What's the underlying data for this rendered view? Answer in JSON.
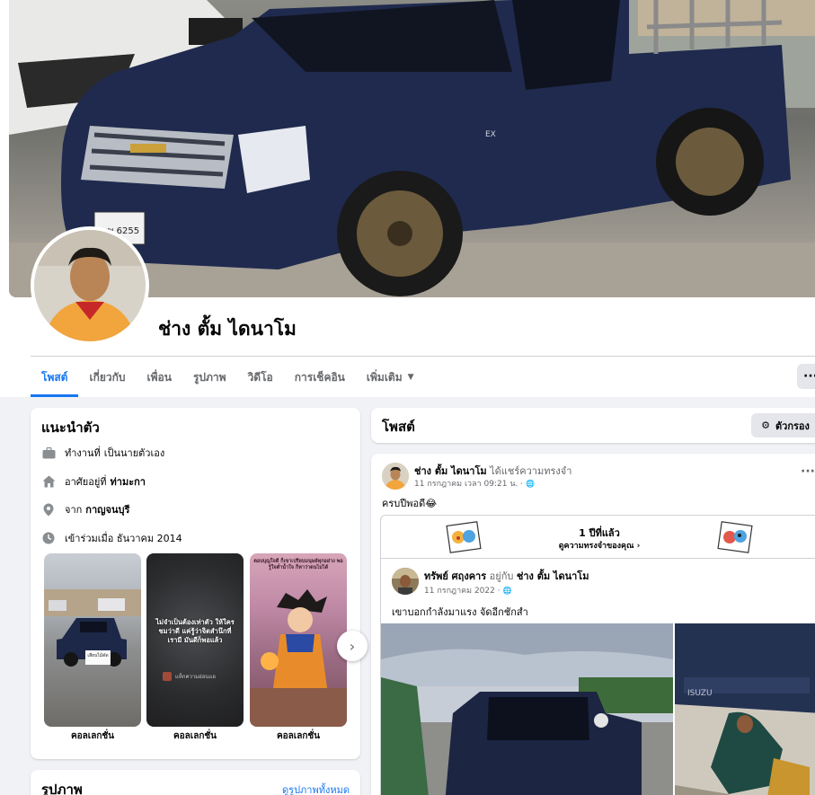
{
  "profile": {
    "name": "ช่าง ตั้ม ไดนาโม",
    "cover_plate": "ฒพ 6255",
    "cover_badge": "EX"
  },
  "tabs": [
    {
      "label": "โพสต์",
      "active": true
    },
    {
      "label": "เกี่ยวกับ"
    },
    {
      "label": "เพื่อน"
    },
    {
      "label": "รูปภาพ"
    },
    {
      "label": "วิดีโอ"
    },
    {
      "label": "การเช็คอิน"
    },
    {
      "label": "เพิ่มเติม"
    }
  ],
  "more_button": "···",
  "intro": {
    "title": "แนะนำตัว",
    "work": {
      "prefix": "ทำงานที่",
      "value": "เป็นนายตัวเอง"
    },
    "lives": {
      "prefix": "อาศัยอยู่ที่",
      "value": "ท่ามะกา"
    },
    "from": {
      "prefix": "จาก",
      "value": "กาญจนบุรี"
    },
    "joined": "เข้าร่วมเมื่อ ธันวาคม 2014",
    "collections": [
      {
        "label": "คอลเลกชั่น",
        "caption": "เสียบไม้ดัด"
      },
      {
        "label": "คอลเลกชั่น",
        "caption": "ไม่จำเป็นต้องเท่าตัว ให้ใครชมว่าดี แค่รู้ว่าจิตสำนึกที่เรามี มันดีก็พอแล้ว",
        "sub": "แท็กความอ่อนแอ"
      },
      {
        "label": "คอลเลกชั่น",
        "caption": "ตอบบุญใจดี ก็เขาเปรียบมนุษย์ทุกอย่าง พอรู้ใจต่ำน้ำใจ ก็หาว่าตนไม่ได้"
      }
    ]
  },
  "photos_card": {
    "title": "รูปภาพ",
    "link": "ดูรูปภาพทั้งหมด"
  },
  "posts_header": {
    "title": "โพสต์",
    "filter": "ตัวกรอง"
  },
  "post": {
    "author": "ช่าง ตั้ม ไดนาโม",
    "action": "ได้แชร์ความทรงจำ",
    "time": "11 กรกฎาคม เวลา 09:21 น. ·",
    "text": "ครบปีพอดี😂",
    "memory": {
      "title": "1 ปีที่แล้ว",
      "subtitle": "ดูความทรงจำของคุณ",
      "shared_author": "ทรัพย์ ศฤงคาร",
      "with_text": "อยู่กับ",
      "with_name": "ช่าง ตั้ม ไดนาโม",
      "shared_time": "11 กรกฎาคม 2022 ·",
      "shared_text": "เขาบอกกำลังมาแรง จัดอีกชักสำ",
      "photo2_badge": "ISUZU"
    }
  },
  "colors": {
    "accent": "#1877f2",
    "background": "#f0f2f5",
    "text_muted": "#65676b"
  }
}
